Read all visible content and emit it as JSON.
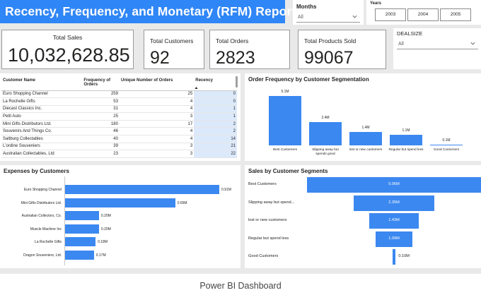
{
  "header": {
    "title": "Recency, Frequency, and Monetary (RFM) Report"
  },
  "slicers": {
    "months": {
      "label": "Months",
      "value": "All"
    },
    "years": {
      "label": "Years",
      "options": [
        "2003",
        "2004",
        "2005"
      ]
    },
    "dealsize": {
      "label": "DEALSIZE",
      "value": "All"
    }
  },
  "kpis": [
    {
      "label": "Total Sales",
      "value": "10,032,628.85"
    },
    {
      "label": "Total Customers",
      "value": "92"
    },
    {
      "label": "Total Orders",
      "value": "2823"
    },
    {
      "label": "Total Products Sold",
      "value": "99067"
    }
  ],
  "table": {
    "columns": [
      "Customer Name",
      "Frequency of Orders",
      "Unique Number of Orders",
      "Recency"
    ],
    "sort_column": "Recency",
    "rows": [
      [
        "Euro Shopping Channel",
        "259",
        "25",
        "0"
      ],
      [
        "La Rochelle Gifts",
        "53",
        "4",
        "0"
      ],
      [
        "Diecast Classics Inc.",
        "31",
        "4",
        "1"
      ],
      [
        "Petit Auto",
        "25",
        "3",
        "1"
      ],
      [
        "Mini Gifts Distributors Ltd.",
        "180",
        "17",
        "2"
      ],
      [
        "Souvenirs And Things Co.",
        "46",
        "4",
        "2"
      ],
      [
        "Saltburg Collectables",
        "40",
        "4",
        "14"
      ],
      [
        "L'ordine Souveniers",
        "39",
        "3",
        "21"
      ],
      [
        "Australian Collectables, Ltd",
        "23",
        "3",
        "22"
      ]
    ]
  },
  "chart_data": [
    {
      "type": "bar",
      "title": "Order Frequency by Customer Segmentation",
      "categories": [
        "Best Customers",
        "Slipping away but spends good",
        "lost or new customers",
        "Regular but spend less",
        "Good Customers"
      ],
      "values": [
        5.1,
        2.4,
        1.4,
        1.1,
        0.1
      ],
      "value_labels": [
        "5.1M",
        "2.4M",
        "1.4M",
        "1.1M",
        "0.1M"
      ],
      "ylim": [
        0,
        5.1
      ],
      "color": "#3b88f0"
    },
    {
      "type": "bar",
      "orientation": "horizontal",
      "title": "Expenses by Customers",
      "categories": [
        "Euro Shopping Channel",
        "Mini Gifts Distributors Ltd.",
        "Australian Collectors, Co.",
        "Muscle Machine Inc",
        "La Rochelle Gifts",
        "Dragon Souveniers, Ltd."
      ],
      "values": [
        0.91,
        0.65,
        0.2,
        0.2,
        0.18,
        0.17
      ],
      "value_labels": [
        "0.91M",
        "0.65M",
        "0.20M",
        "0.20M",
        "0.18M",
        "0.17M"
      ],
      "xlim": [
        0,
        0.91
      ],
      "color": "#3b88f0"
    },
    {
      "type": "funnel",
      "title": "Sales by Customer Segments",
      "categories": [
        "Best Customers",
        "Slipping away but spend...",
        "lost or new customers",
        "Regular but spend less",
        "Good Customers"
      ],
      "values": [
        5.06,
        2.35,
        1.43,
        1.09,
        0.1
      ],
      "value_labels": [
        "5.06M",
        "2.35M",
        "1.43M",
        "1.09M",
        "0.10M"
      ],
      "color": "#3b88f0"
    }
  ],
  "caption": "Power BI Dashboard"
}
